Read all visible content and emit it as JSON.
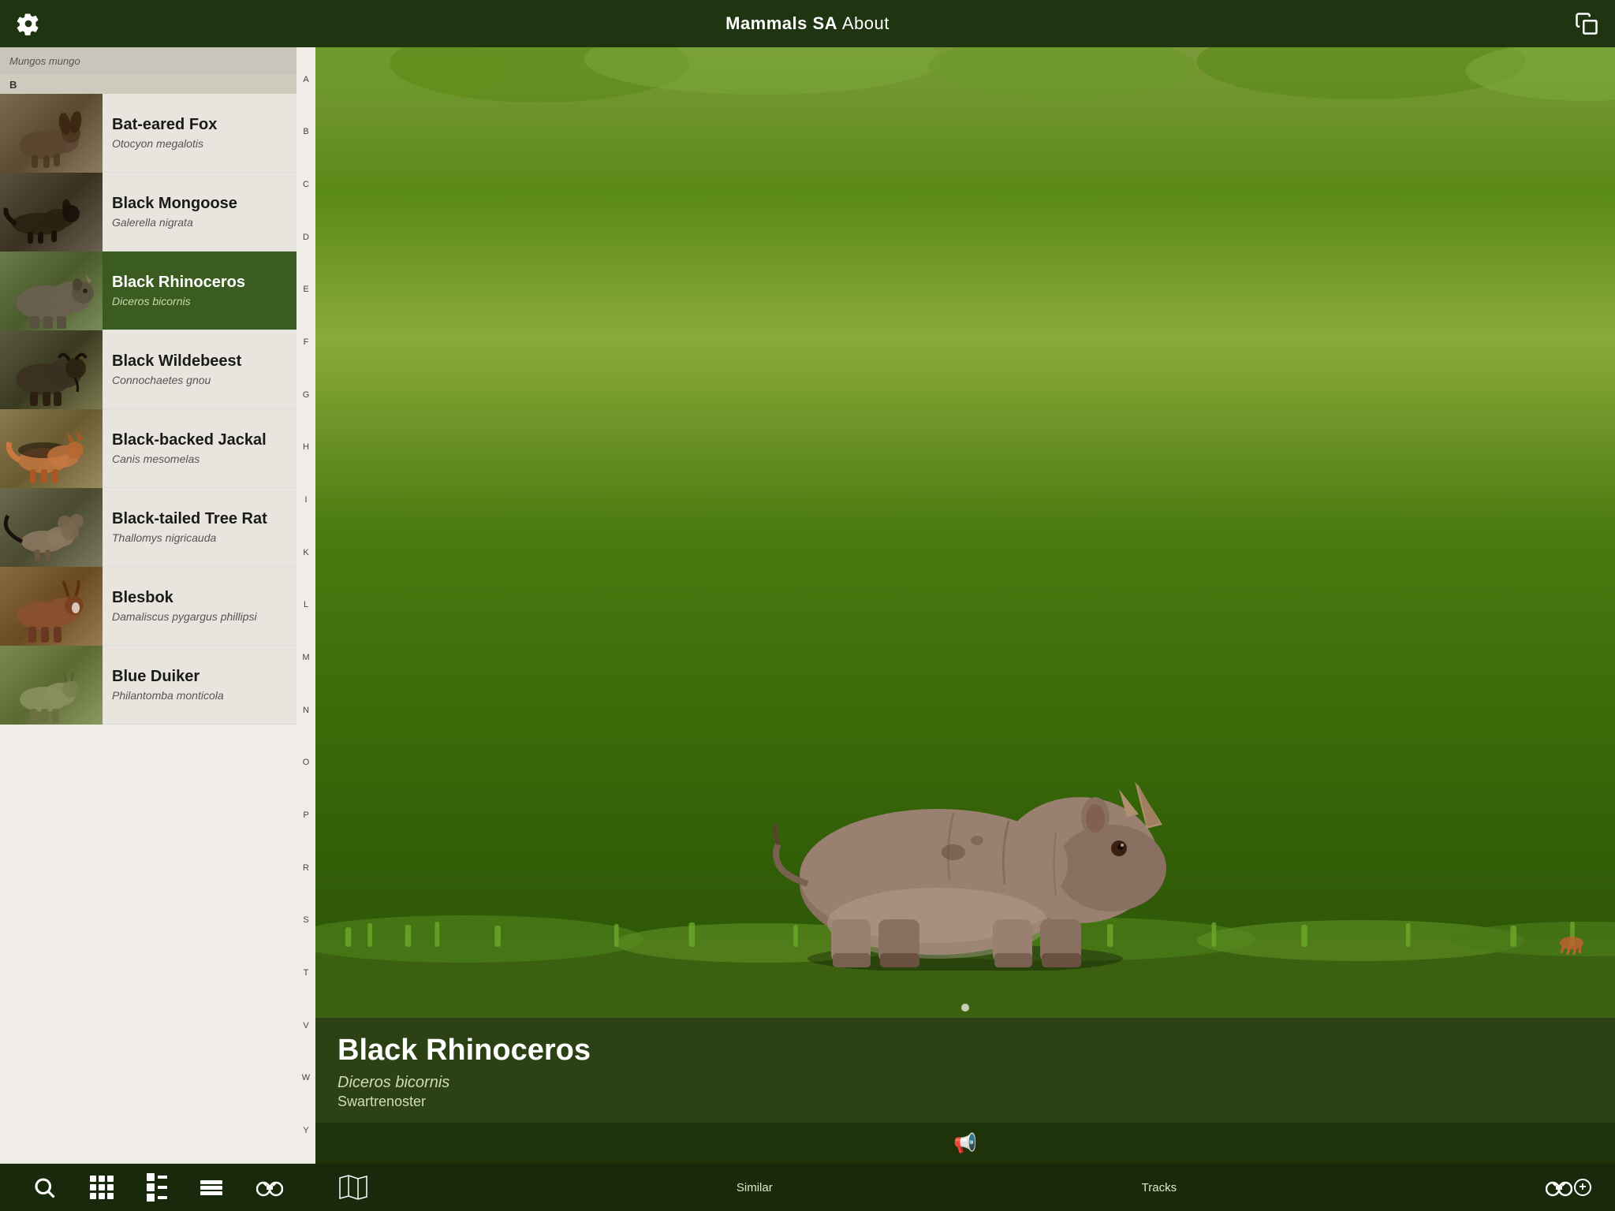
{
  "app": {
    "title": "Mammals SA",
    "about_label": "About",
    "copy_icon": "copy",
    "gear_icon": "gear"
  },
  "header": {
    "title": "Mammals SA",
    "about": "About"
  },
  "alphabet": [
    "A",
    "B",
    "C",
    "D",
    "E",
    "F",
    "G",
    "H",
    "I",
    "K",
    "L",
    "M",
    "N",
    "O",
    "P",
    "R",
    "S",
    "T",
    "V",
    "W",
    "Y"
  ],
  "list": {
    "section_header": "B",
    "scrolled_item": "Mungos mungo",
    "items": [
      {
        "name": "Bat-eared Fox",
        "latin": "Otocyon megalotis",
        "thumb_class": "thumb-bat-eared-fox",
        "active": false
      },
      {
        "name": "Black Mongoose",
        "latin": "Galerella nigrata",
        "thumb_class": "thumb-black-mongoose",
        "active": false
      },
      {
        "name": "Black Rhinoceros",
        "latin": "Diceros bicornis",
        "thumb_class": "thumb-black-rhino",
        "active": true
      },
      {
        "name": "Black Wildebeest",
        "latin": "Connochaetes gnou",
        "thumb_class": "thumb-black-wildebeest",
        "active": false
      },
      {
        "name": "Black-backed Jackal",
        "latin": "Canis mesomelas",
        "thumb_class": "thumb-black-backed-jackal",
        "active": false
      },
      {
        "name": "Black-tailed Tree Rat",
        "latin": "Thallomys nigricauda",
        "thumb_class": "thumb-black-tailed-rat",
        "active": false
      },
      {
        "name": "Blesbok",
        "latin": "Damaliscus pygargus phillipsi",
        "thumb_class": "thumb-blesbok",
        "active": false
      },
      {
        "name": "Blue Duiker",
        "latin": "Philantomba monticola",
        "thumb_class": "thumb-blue-duiker",
        "active": false
      }
    ]
  },
  "detail": {
    "common_name": "Black Rhinoceros",
    "latin_name": "Diceros bicornis",
    "local_name": "Swartrenoster"
  },
  "bottom_toolbar": {
    "search_label": "search",
    "grid_label": "grid",
    "list_compact_label": "list-compact",
    "list_full_label": "list-full",
    "binoculars_label": "binoculars",
    "map_label": "map",
    "similar_label": "Similar",
    "tracks_label": "Tracks",
    "binoculars_plus_label": "binoculars-plus"
  }
}
